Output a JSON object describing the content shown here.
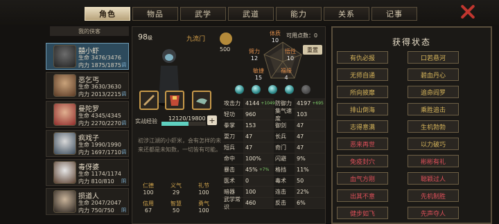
{
  "tabs": [
    "角色",
    "物品",
    "武学",
    "武道",
    "能力",
    "关系",
    "记事"
  ],
  "active_tab": "角色",
  "sidebar": {
    "title": "我的侠客",
    "chars": [
      {
        "name": "囍小虾",
        "hp": "生命 3476/3476",
        "mp": "内力 1875/1875",
        "tag": "调"
      },
      {
        "name": "恶乞丐",
        "hp": "生命 3630/3630",
        "mp": "内力 2013/2215",
        "tag": "调"
      },
      {
        "name": "曼陀罗",
        "hp": "生命 4345/4345",
        "mp": "内力 2270/2270",
        "tag": "调"
      },
      {
        "name": "疯戏子",
        "hp": "生命 1990/1990",
        "mp": "内力 1697/1710",
        "tag": "调"
      },
      {
        "name": "毒伢婆",
        "hp": "生命 1174/1174",
        "mp": "内力 810/810",
        "tag": "阴"
      },
      {
        "name": "损道人",
        "hp": "生命 2047/2047",
        "mp": "内力 750/750",
        "tag": "阴"
      }
    ]
  },
  "profile": {
    "level": "98",
    "level_unit": "级",
    "sect": "九流门",
    "coins": "500",
    "exp_label": "实战经验",
    "exp_value": "12120/19800",
    "exp_fraction": 0.61,
    "description": "初涉江湖的小虾米，会有怎样的未来还都是未知数，一切皆有可能。"
  },
  "attributes": {
    "points_label": "可用点数：",
    "points": "0",
    "reset": "重置",
    "tizhi": {
      "label": "体质",
      "value": "10"
    },
    "biliu": {
      "label": "臂力",
      "value": "12"
    },
    "wuxing": {
      "label": "悟性",
      "value": "10"
    },
    "minjie": {
      "label": "敏捷",
      "value": "15"
    },
    "fuyuan": {
      "label": "福缘",
      "value": "4"
    }
  },
  "stats": [
    [
      {
        "k": "攻击力",
        "v": "4144",
        "b": "+1049"
      },
      {
        "k": "防御力",
        "v": "4197",
        "b": "+695"
      }
    ],
    [
      {
        "k": "轻功",
        "v": "960"
      },
      {
        "k": "集气速度",
        "v": "103"
      }
    ],
    [
      {
        "k": "拳掌",
        "v": "153"
      },
      {
        "k": "御剑",
        "v": "47"
      }
    ],
    [
      {
        "k": "耍刀",
        "v": "47"
      },
      {
        "k": "长兵",
        "v": "47"
      }
    ],
    [
      {
        "k": "短兵",
        "v": "47"
      },
      {
        "k": "奇门",
        "v": "47"
      }
    ],
    [
      {
        "k": "命中",
        "v": "100%"
      },
      {
        "k": "闪避",
        "v": "9%"
      }
    ],
    [
      {
        "k": "暴击",
        "v": "45%",
        "b": "+7%"
      },
      {
        "k": "格挡",
        "v": "11%"
      }
    ],
    [
      {
        "k": "医术",
        "v": "0"
      },
      {
        "k": "毒术",
        "v": "50"
      }
    ],
    [
      {
        "k": "暗器",
        "v": "100"
      },
      {
        "k": "连击",
        "v": "22%"
      }
    ],
    [
      {
        "k": "武学常识",
        "v": "460"
      },
      {
        "k": "反击",
        "v": "6%"
      }
    ]
  ],
  "virtues": [
    {
      "k": "仁德",
      "v": "100"
    },
    {
      "k": "义气",
      "v": "29"
    },
    {
      "k": "礼节",
      "v": "100"
    },
    {
      "k": "信用",
      "v": "67"
    },
    {
      "k": "智慧",
      "v": "50"
    },
    {
      "k": "勇气",
      "v": "100"
    }
  ],
  "status": {
    "title": "获得状态",
    "items": [
      {
        "t": "有仇必报",
        "red": false
      },
      {
        "t": "口若悬河",
        "red": false
      },
      {
        "t": "无师自通",
        "red": false
      },
      {
        "t": "碧血丹心",
        "red": false
      },
      {
        "t": "所向披靡",
        "red": false
      },
      {
        "t": "追命阎罗",
        "red": false
      },
      {
        "t": "排山倒海",
        "red": false
      },
      {
        "t": "乘胜追击",
        "red": false
      },
      {
        "t": "志得意满",
        "red": false
      },
      {
        "t": "生机勃勃",
        "red": false
      },
      {
        "t": "恶来再世",
        "red": true
      },
      {
        "t": "以力破巧",
        "red": false
      },
      {
        "t": "免疫封穴",
        "red": true
      },
      {
        "t": "彬彬有礼",
        "red": true
      },
      {
        "t": "血气方刚",
        "red": true
      },
      {
        "t": "聪颖过人",
        "red": true
      },
      {
        "t": "出其不意",
        "red": true
      },
      {
        "t": "先机制胜",
        "red": true
      },
      {
        "t": "健步如飞",
        "red": true
      },
      {
        "t": "先声夺人",
        "red": true
      }
    ]
  }
}
